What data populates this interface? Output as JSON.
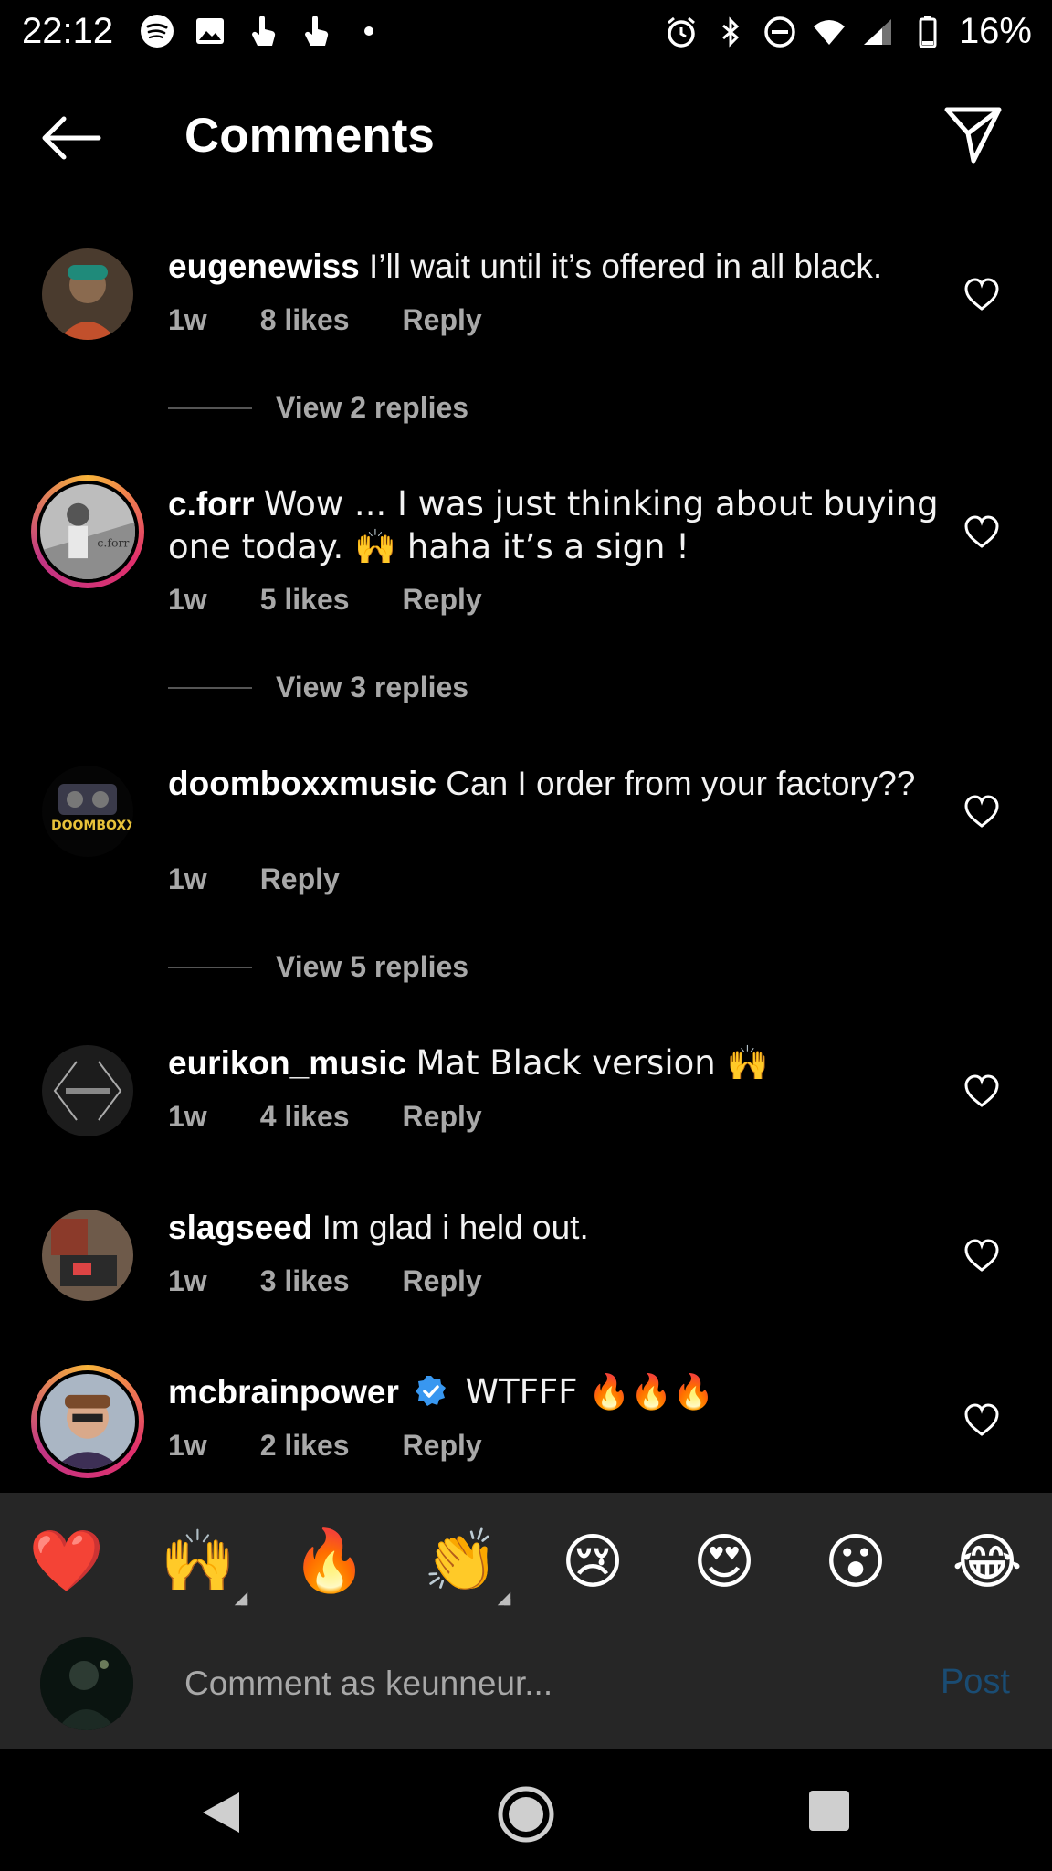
{
  "status_bar": {
    "time": "22:12",
    "battery": "16%",
    "left_icons": [
      "spotify-icon",
      "image-icon",
      "touch-icon",
      "touch-icon",
      "dot-icon"
    ],
    "right_icons": [
      "alarm-icon",
      "bluetooth-icon",
      "dnd-icon",
      "wifi-icon",
      "signal-icon",
      "battery-icon"
    ]
  },
  "header": {
    "title": "Comments"
  },
  "comments": [
    {
      "username": "eugenewiss",
      "text": "I’ll wait until it’s offered in all black.",
      "time": "1w",
      "likes": "8 likes",
      "reply": "Reply",
      "view_replies": "View 2 replies"
    },
    {
      "username": "c.forr",
      "text": "Wow ... I was just thinking about buying one today. 🙌 haha it’s a sign !",
      "time": "1w",
      "likes": "5 likes",
      "reply": "Reply",
      "view_replies": "View 3 replies"
    },
    {
      "username": "doomboxxmusic",
      "text": "Can I order from your factory??",
      "time": "1w",
      "reply": "Reply",
      "view_replies": "View 5 replies"
    },
    {
      "username": "eurikon_music",
      "text": "Mat Black version 🙌",
      "time": "1w",
      "likes": "4 likes",
      "reply": "Reply"
    },
    {
      "username": "slagseed",
      "text": "Im glad i held out.",
      "time": "1w",
      "likes": "3 likes",
      "reply": "Reply"
    },
    {
      "username": "mcbrainpower",
      "text": "WTFFF 🔥🔥🔥",
      "time": "1w",
      "likes": "2 likes",
      "reply": "Reply"
    }
  ],
  "reactions": [
    "❤️",
    "🙌",
    "🔥",
    "👏",
    "😢",
    "😍",
    "😮",
    "😂"
  ],
  "composer": {
    "placeholder": "Comment as keunneur...",
    "post_label": "Post"
  },
  "colors": {
    "background": "#000000",
    "muted_text": "#a8a8a8",
    "composer_bg": "#262626",
    "post_disabled": "#1a4c73",
    "verified": "#3897f0"
  }
}
